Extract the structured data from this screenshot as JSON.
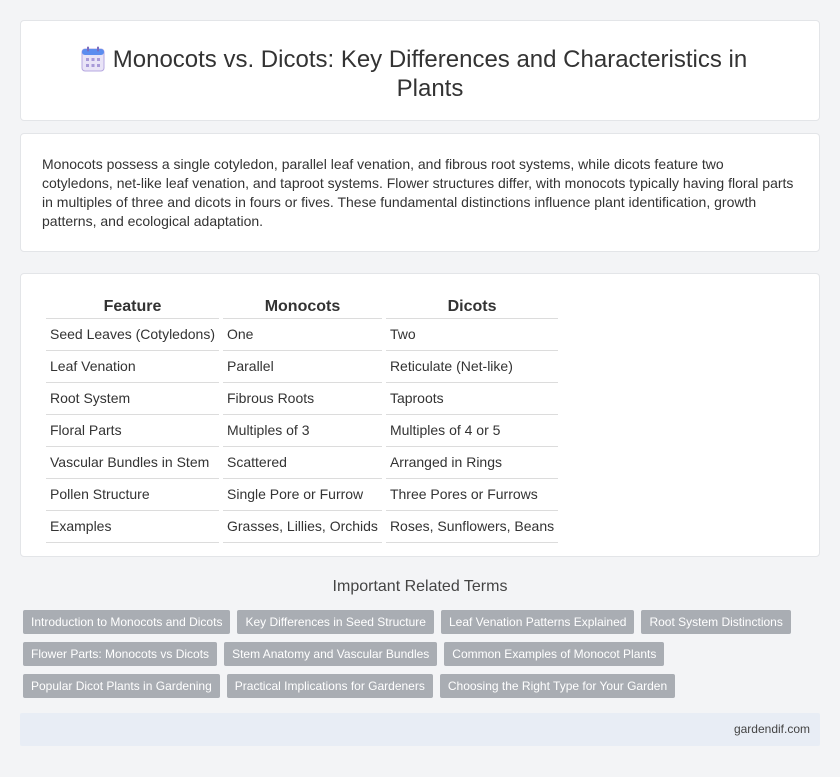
{
  "header": {
    "icon": "calendar-icon",
    "title": "Monocots vs. Dicots: Key Differences and Characteristics in Plants"
  },
  "summary": "Monocots possess a single cotyledon, parallel leaf venation, and fibrous root systems, while dicots feature two cotyledons, net-like leaf venation, and taproot systems. Flower structures differ, with monocots typically having floral parts in multiples of three and dicots in fours or fives. These fundamental distinctions influence plant identification, growth patterns, and ecological adaptation.",
  "table": {
    "headers": [
      "Feature",
      "Monocots",
      "Dicots"
    ],
    "rows": [
      [
        "Seed Leaves (Cotyledons)",
        "One",
        "Two"
      ],
      [
        "Leaf Venation",
        "Parallel",
        "Reticulate (Net-like)"
      ],
      [
        "Root System",
        "Fibrous Roots",
        "Taproots"
      ],
      [
        "Floral Parts",
        "Multiples of 3",
        "Multiples of 4 or 5"
      ],
      [
        "Vascular Bundles in Stem",
        "Scattered",
        "Arranged in Rings"
      ],
      [
        "Pollen Structure",
        "Single Pore or Furrow",
        "Three Pores or Furrows"
      ],
      [
        "Examples",
        "Grasses, Lillies, Orchids",
        "Roses, Sunflowers, Beans"
      ]
    ]
  },
  "related": {
    "title": "Important Related Terms",
    "rows": [
      [
        "Introduction to Monocots and Dicots",
        "Key Differences in Seed Structure",
        "Leaf Venation Patterns Explained",
        "Root System Distinctions"
      ],
      [
        "Flower Parts: Monocots vs Dicots",
        "Stem Anatomy and Vascular Bundles",
        "Common Examples of Monocot Plants"
      ],
      [
        "Popular Dicot Plants in Gardening",
        "Practical Implications for Gardeners",
        "Choosing the Right Type for Your Garden"
      ]
    ]
  },
  "footer": {
    "site": "gardendif.com"
  },
  "colors": {
    "tag_bg": "#a9adb3",
    "footer_bg": "#e8edf5",
    "icon_accent": "#5b8def"
  }
}
